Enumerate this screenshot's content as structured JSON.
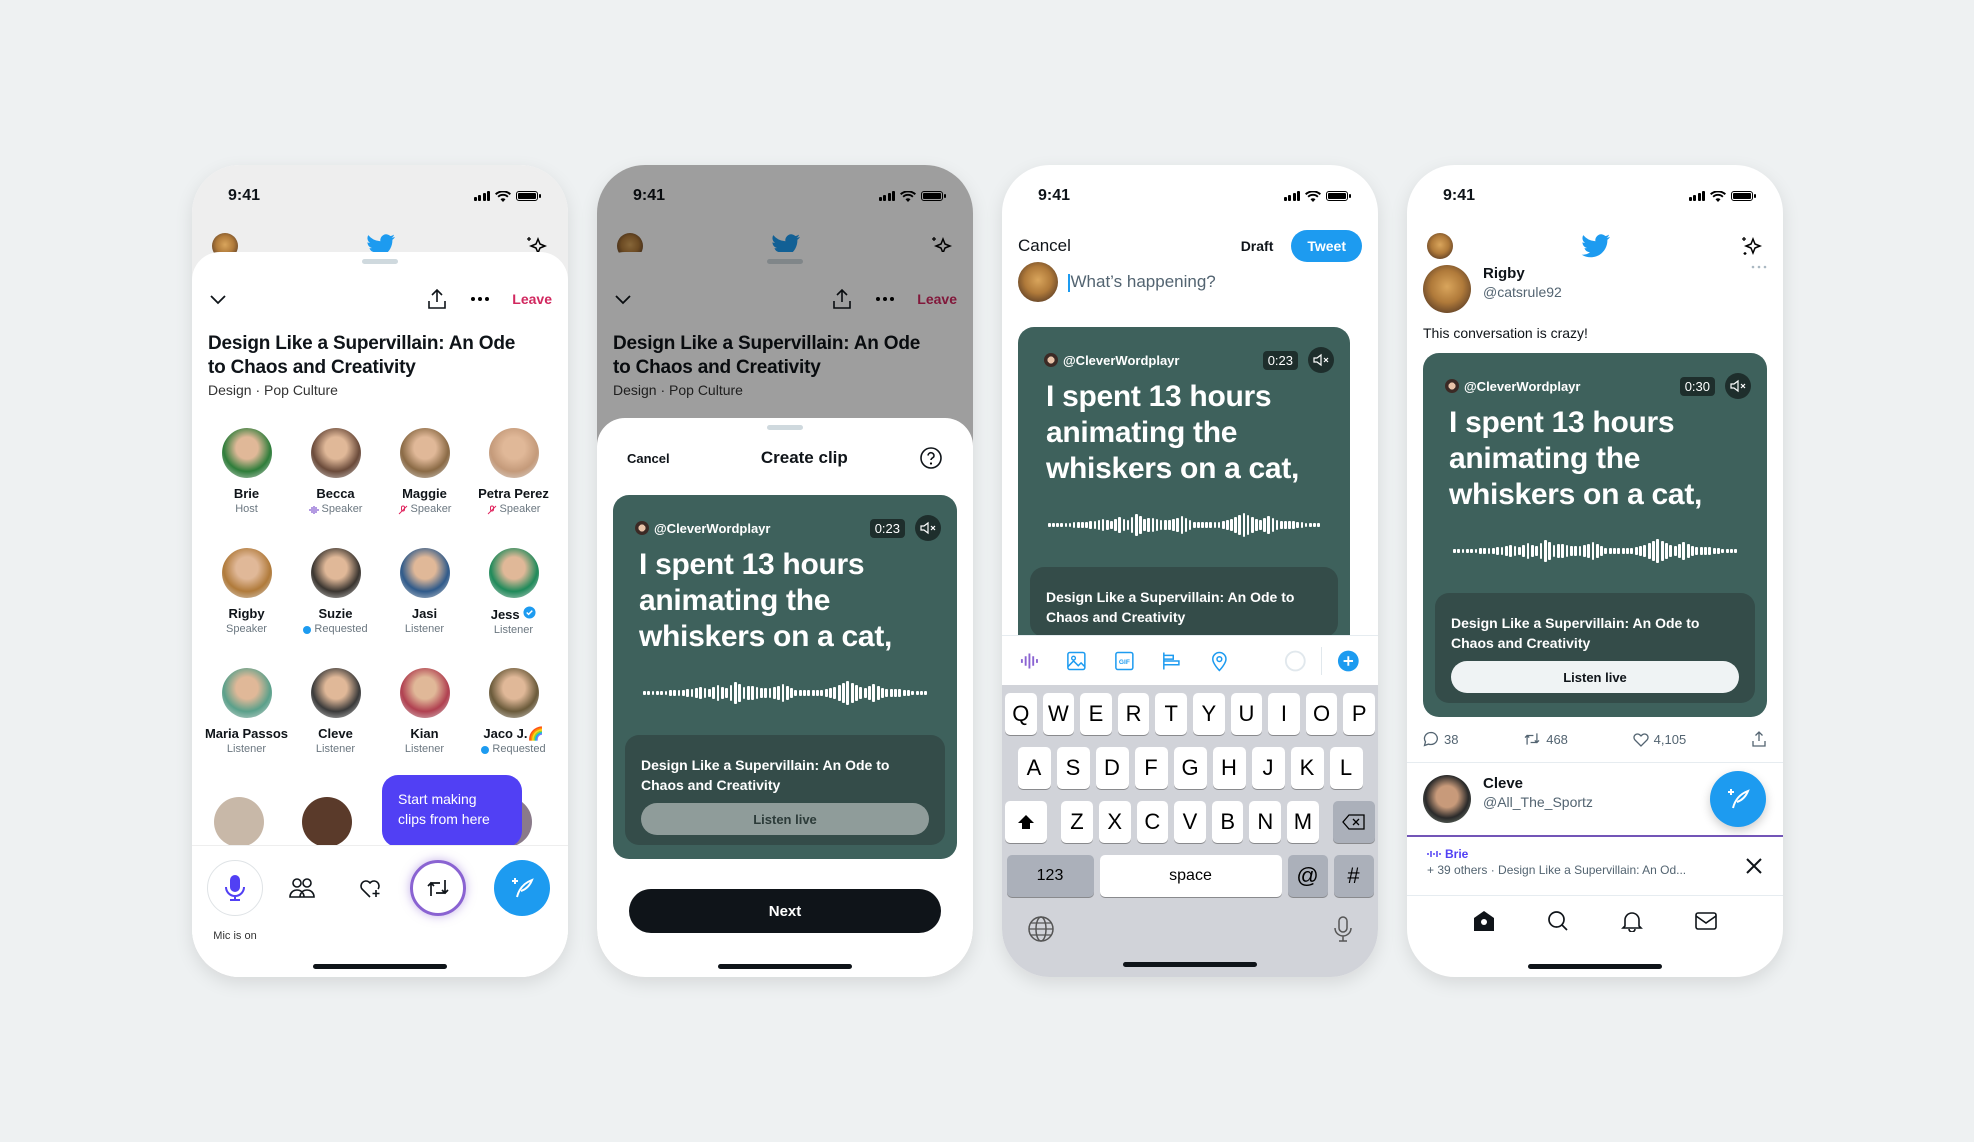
{
  "status": {
    "time": "9:41"
  },
  "space": {
    "title": "Design Like a Supervillain: An Ode to Chaos and Creativity",
    "topics": "Design · Pop Culture",
    "leave_label": "Leave",
    "participants": [
      {
        "name": "Brie",
        "role": "Host",
        "badge": "none",
        "color": "#2e7d3a"
      },
      {
        "name": "Becca",
        "role": "Speaker",
        "badge": "speaking",
        "color": "#6a4a3a"
      },
      {
        "name": "Maggie",
        "role": "Speaker",
        "badge": "muted",
        "color": "#8a6a45"
      },
      {
        "name": "Petra Perez",
        "role": "Speaker",
        "badge": "muted",
        "color": "#c49a7a"
      },
      {
        "name": "Rigby",
        "role": "Speaker",
        "badge": "none",
        "color": "#b07a3a"
      },
      {
        "name": "Suzie",
        "role": "Requested",
        "badge": "requested",
        "color": "#3a3530"
      },
      {
        "name": "Jasi",
        "role": "Listener",
        "badge": "none",
        "color": "#2f5a8a"
      },
      {
        "name": "Jess",
        "role": "Listener",
        "badge": "verified",
        "color": "#1f8a5a"
      },
      {
        "name": "Maria Passos",
        "role": "Listener",
        "badge": "none",
        "color": "#5aa08a"
      },
      {
        "name": "Cleve",
        "role": "Listener",
        "badge": "none",
        "color": "#3a3a3a"
      },
      {
        "name": "Kian",
        "role": "Listener",
        "badge": "none",
        "color": "#b04050"
      },
      {
        "name": "Jaco J.🌈",
        "role": "Requested",
        "badge": "requested",
        "color": "#6a5a3a"
      }
    ],
    "tooltip": "Start making clips from here",
    "mic_label": "Mic is on"
  },
  "clip_sheet": {
    "cancel_label": "Cancel",
    "title": "Create clip",
    "next_label": "Next"
  },
  "clip": {
    "handle": "@CleverWordplayr",
    "duration_create": "0:23",
    "duration_feed": "0:30",
    "quote": "I spent 13 hours animating the whiskers on a cat,",
    "space_title": "Design Like a Supervillain: An Ode to Chaos and Creativity",
    "listen_label": "Listen live"
  },
  "compose": {
    "cancel_label": "Cancel",
    "draft_label": "Draft",
    "tweet_label": "Tweet",
    "placeholder": "What’s happening?",
    "keyboard": {
      "row1": [
        "Q",
        "W",
        "E",
        "R",
        "T",
        "Y",
        "U",
        "I",
        "O",
        "P"
      ],
      "row2": [
        "A",
        "S",
        "D",
        "F",
        "G",
        "H",
        "J",
        "K",
        "L"
      ],
      "row3": [
        "Z",
        "X",
        "C",
        "V",
        "B",
        "N",
        "M"
      ],
      "numbers_label": "123",
      "space_label": "space",
      "at_label": "@",
      "hash_label": "#"
    }
  },
  "feed": {
    "tweet": {
      "name": "Rigby",
      "handle": "@catsrule92",
      "text": "This conversation is crazy!",
      "replies": "38",
      "retweets": "468",
      "likes": "4,105"
    },
    "next_user": {
      "name": "Cleve",
      "handle": "@All_The_Sportz"
    },
    "space_bar": {
      "host": "Brie",
      "subtitle": "+ 39 others · Design Like a Supervillain: An Od..."
    }
  },
  "colors": {
    "accent": "#1d9bf0",
    "leave": "#d1285f",
    "clip_bg": "#3e615c",
    "tooltip": "#5140f4"
  }
}
